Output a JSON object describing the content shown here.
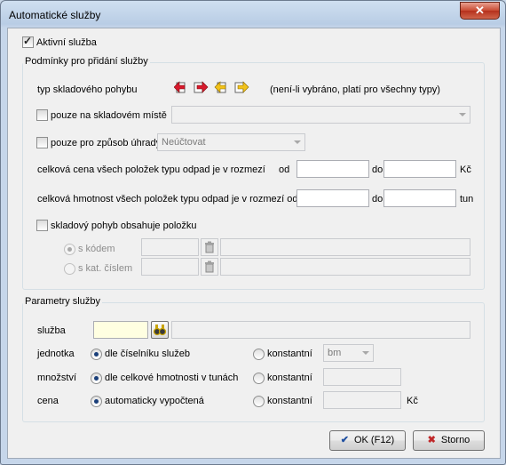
{
  "window": {
    "title": "Automatické služby",
    "close_glyph": "✕"
  },
  "active": {
    "label": "Aktivní služba",
    "checked": true
  },
  "conditions": {
    "legend": "Podmínky pro přidání služby",
    "movement_type_label": "typ skladového pohybu",
    "movement_type_note": "(není-li vybráno, platí pro všechny typy)",
    "movement_icons": [
      "receipt-icon",
      "issue-icon",
      "transfer-in-icon",
      "transfer-out-icon"
    ],
    "location_label": "pouze na skladovém místě",
    "location_value": "",
    "payment_label": "pouze pro způsob úhrady",
    "payment_value": "Neúčtovat",
    "price_label": "celková cena všech položek typu odpad je v rozmezí",
    "price_from": "od",
    "price_to": "do",
    "price_unit": "Kč",
    "weight_label": "celková hmotnost všech položek typu odpad je v rozmezí od",
    "weight_to": "do",
    "weight_unit": "tun",
    "contains_label": "skladový pohyb obsahuje položku",
    "code_label": "s kódem",
    "catalog_label": "s kat. číslem"
  },
  "params": {
    "legend": "Parametry služby",
    "service_label": "služba",
    "unit_label": "jednotka",
    "unit_option1": "dle číselníku služeb",
    "unit_option2": "konstantní",
    "unit_value": "bm",
    "qty_label": "množství",
    "qty_option1": "dle celkové hmotnosti v tunách",
    "qty_option2": "konstantní",
    "price_label": "cena",
    "price_option1": "automaticky vypočtená",
    "price_option2": "konstantní",
    "price_unit": "Kč"
  },
  "buttons": {
    "ok": "OK (F12)",
    "cancel": "Storno"
  },
  "colors": {
    "accent": "#1a3f7a",
    "yellow_field": "#ffffe1",
    "ok_check": "#1f4fa0",
    "cancel_x": "#c0282a"
  }
}
